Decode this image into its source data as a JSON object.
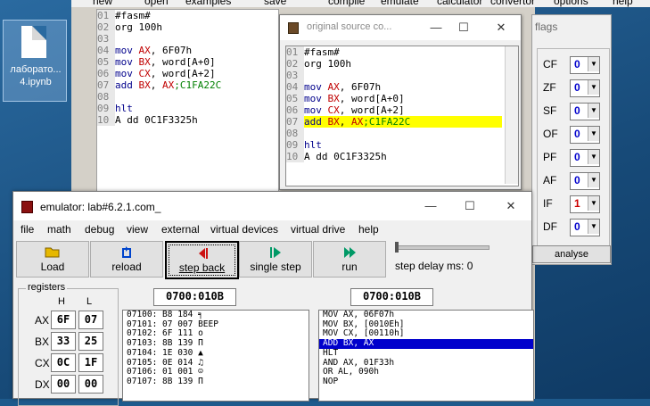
{
  "desktop": {
    "icon_label": "лаборато...\n4.ipynb"
  },
  "editor_toolbar": [
    "new",
    "open",
    "examples",
    "save",
    "compile",
    "emulate",
    "calculator",
    "convertor",
    "options",
    "help"
  ],
  "editor": {
    "lines": [
      {
        "n": "01",
        "text": "#fasm#"
      },
      {
        "n": "02",
        "text": "org 100h"
      },
      {
        "n": "03",
        "text": ""
      },
      {
        "n": "04",
        "text": "mov AX, 6F07h"
      },
      {
        "n": "05",
        "text": "mov BX, word[A+0]"
      },
      {
        "n": "06",
        "text": "mov CX, word[A+2]"
      },
      {
        "n": "07",
        "text": "add BX, AX;C1FA22C"
      },
      {
        "n": "08",
        "text": ""
      },
      {
        "n": "09",
        "text": "hlt"
      },
      {
        "n": "10",
        "text": "A dd 0C1F3325h"
      }
    ]
  },
  "source_window": {
    "title": "original source co...",
    "controls": {
      "min": "—",
      "max": "☐",
      "close": "✕"
    },
    "highlight_line": "07"
  },
  "flags": {
    "title": "flags",
    "items": [
      {
        "name": "CF",
        "value": "0"
      },
      {
        "name": "ZF",
        "value": "0"
      },
      {
        "name": "SF",
        "value": "0"
      },
      {
        "name": "OF",
        "value": "0"
      },
      {
        "name": "PF",
        "value": "0"
      },
      {
        "name": "AF",
        "value": "0"
      },
      {
        "name": "IF",
        "value": "1"
      },
      {
        "name": "DF",
        "value": "0"
      }
    ],
    "analyse_label": "analyse",
    "value_color": "#0000cc",
    "set_color": "#cc0000"
  },
  "emulator": {
    "title": "emulator: lab#6.2.1.com_",
    "controls": {
      "min": "—",
      "max": "☐",
      "close": "✕"
    },
    "menu": [
      "file",
      "math",
      "debug",
      "view",
      "external",
      "virtual devices",
      "virtual drive",
      "help"
    ],
    "buttons": {
      "load": "Load",
      "reload": "reload",
      "step_back": "step back",
      "single_step": "single step",
      "run": "run"
    },
    "step_delay_label": "step delay ms: 0",
    "step_delay_value": 0,
    "registers": {
      "legend": "registers",
      "h_label": "H",
      "l_label": "L",
      "rows": [
        {
          "name": "AX",
          "h": "6F",
          "l": "07"
        },
        {
          "name": "BX",
          "h": "33",
          "l": "25"
        },
        {
          "name": "CX",
          "h": "0C",
          "l": "1F"
        },
        {
          "name": "DX",
          "h": "00",
          "l": "00"
        }
      ]
    },
    "mem_address": "0700:010B",
    "dis_address": "0700:010B",
    "memory": [
      "07100: B8 184 ╕",
      "07101: 07 007 BEEP",
      "07102: 6F 111 o",
      "07103: 8B 139 П",
      "07104: 1E 030 ▲",
      "07105: 0E 014 ♫",
      "07106: 01 001 ☺",
      "07107: 8B 139 П"
    ],
    "disassembly": [
      "MOV AX, 06F07h",
      "MOV BX, [0010Eh]",
      "MOV CX, [00110h]",
      "ADD BX, AX",
      "HLT",
      "AND AX, 01F33h",
      "OR AL, 090h",
      "NOP"
    ],
    "selected_dis_index": 3
  }
}
